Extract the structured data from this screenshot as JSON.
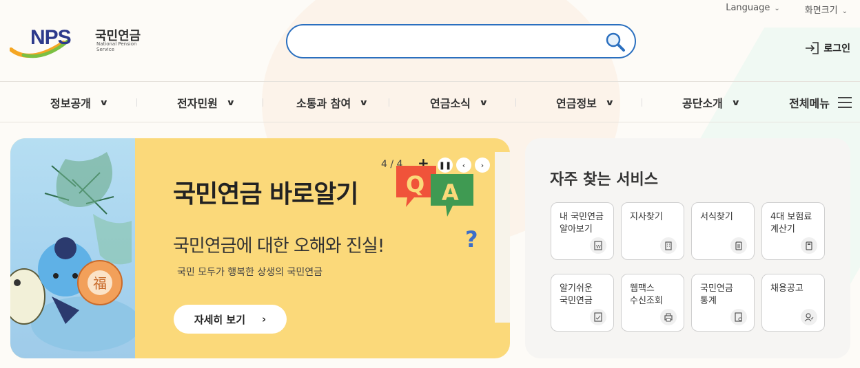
{
  "utility": {
    "language": "Language",
    "font_size": "화면크기"
  },
  "logo": {
    "abbr": "NPS",
    "name_ko": "국민연금",
    "name_en": "National Pension Service"
  },
  "search": {
    "value": "",
    "placeholder": ""
  },
  "header": {
    "login": "로그인"
  },
  "nav": {
    "items": [
      "정보공개",
      "전자민원",
      "소통과 참여",
      "연금소식",
      "연금정보",
      "공단소개"
    ],
    "all_menu": "전체메뉴"
  },
  "banner": {
    "counter": "4 / 4",
    "plus": "+",
    "title": "국민연금 바로알기",
    "subtitle": "국민연금에 대한 오해와 진실!",
    "description": "국민 모두가 행복한 상생의 국민연금",
    "more_button": "자세히 보기",
    "badge_q": "Q",
    "badge_a": "A",
    "mascot_char": "福"
  },
  "services": {
    "title": "자주 찾는 서비스",
    "tiles": [
      {
        "label": "내 국민연금\n알아보기",
        "icon": "document-won-icon"
      },
      {
        "label": "지사찾기",
        "icon": "building-icon"
      },
      {
        "label": "서식찾기",
        "icon": "clipboard-icon"
      },
      {
        "label": "4대 보험료\n계산기",
        "icon": "calculator-icon"
      },
      {
        "label": "알기쉬운\n국민연금",
        "icon": "document-check-icon"
      },
      {
        "label": "웹팩스\n수신조회",
        "icon": "printer-icon"
      },
      {
        "label": "국민연금\n통계",
        "icon": "document-search-icon"
      },
      {
        "label": "채용공고",
        "icon": "user-check-icon"
      }
    ]
  },
  "colors": {
    "primary": "#2a6fbf",
    "banner_bg": "#fbd97a",
    "logo_blue": "#2d3a8c"
  }
}
